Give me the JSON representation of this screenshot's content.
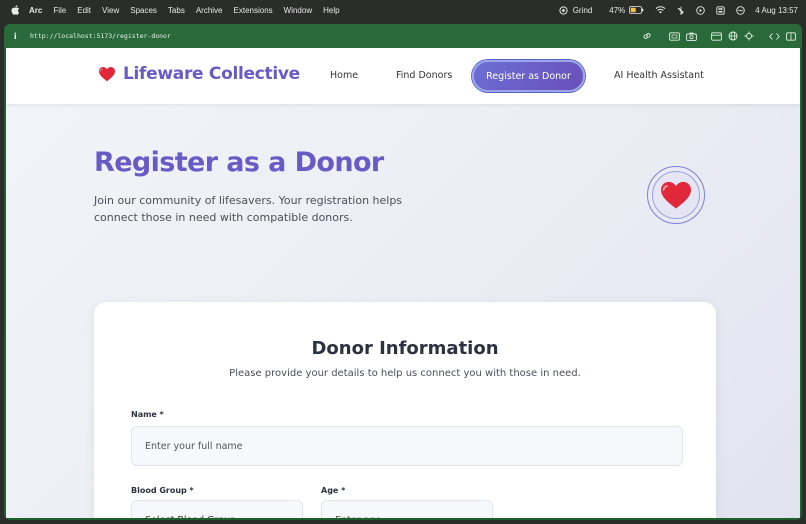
{
  "menubar": {
    "app": "Arc",
    "items": [
      "File",
      "Edit",
      "View",
      "Spaces",
      "Tabs",
      "Archive",
      "Extensions",
      "Window",
      "Help"
    ],
    "status_app": "Grind",
    "battery": "47%",
    "datetime": "4 Aug  13:57"
  },
  "browser": {
    "url": "http://localhost:5173/register-donor"
  },
  "nav": {
    "brand": "Lifeware Collective",
    "home": "Home",
    "find_donors": "Find Donors",
    "register": "Register as Donor",
    "ai_assistant": "AI Health Assistant"
  },
  "hero": {
    "title": "Register as a Donor",
    "subtitle": "Join our community of lifesavers. Your registration helps connect those in need with compatible donors."
  },
  "form": {
    "title": "Donor Information",
    "subtitle": "Please provide your details to help us connect you with those in need.",
    "name_label": "Name *",
    "name_placeholder": "Enter your full name",
    "blood_group_label": "Blood Group *",
    "blood_group_value": "Select Blood Group",
    "age_label": "Age *",
    "age_placeholder": "Enter age"
  },
  "colors": {
    "brand_purple": "#6a5ac6",
    "button_gradient_start": "#6b6fd6",
    "button_gradient_end": "#6a4fb8",
    "heart_red": "#e0283a",
    "browser_chrome_green": "#2a6a3a"
  },
  "icons": {
    "brand": "red-heart-icon",
    "hero": "red-heart-icon"
  }
}
